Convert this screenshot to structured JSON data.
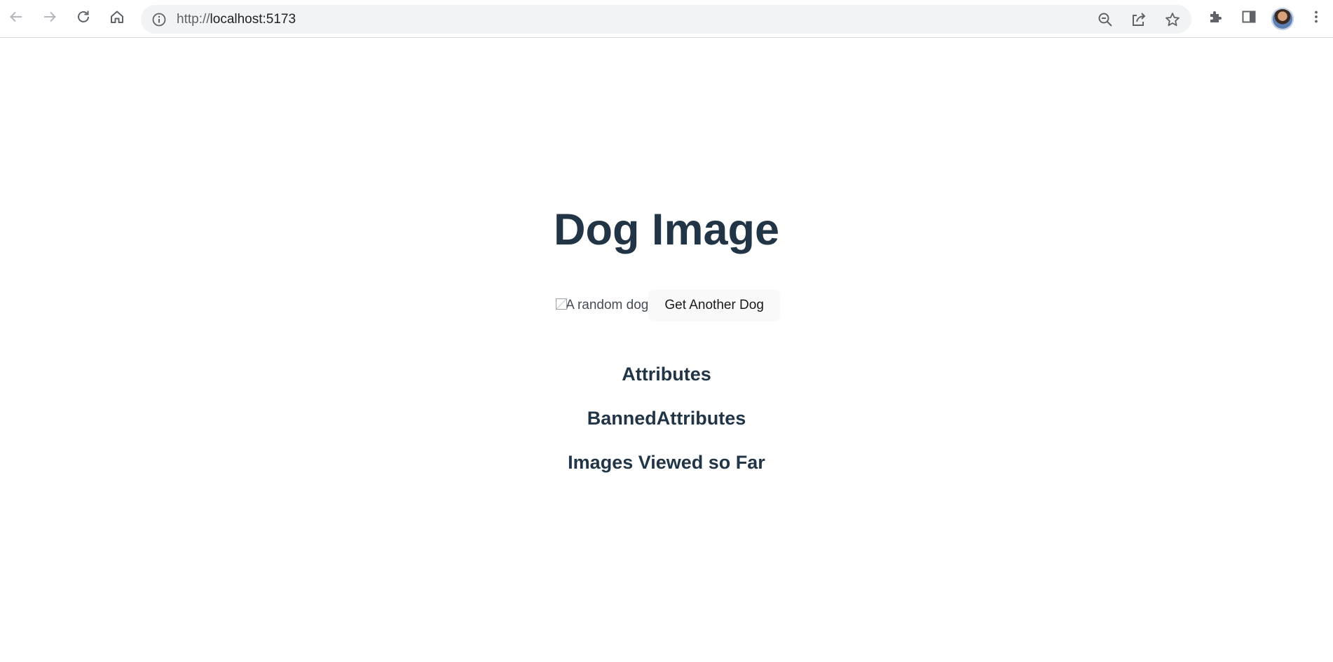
{
  "browser": {
    "url_protocol": "http://",
    "url_host": "localhost:5173",
    "back_icon": "arrow-left-icon",
    "forward_icon": "arrow-right-icon",
    "reload_icon": "reload-icon",
    "home_icon": "home-icon",
    "info_icon": "info-icon",
    "zoom_icon": "zoom-out-icon",
    "share_icon": "share-icon",
    "bookmark_icon": "star-icon",
    "extensions_icon": "puzzle-icon",
    "sidepanel_icon": "side-panel-icon",
    "menu_icon": "more-vert-icon"
  },
  "page": {
    "title": "Dog Image",
    "image_alt": "A random dog",
    "get_button_label": "Get Another Dog",
    "attributes_heading": "Attributes",
    "banned_heading": "BannedAttributes",
    "viewed_heading": "Images Viewed so Far"
  },
  "colors": {
    "heading": "#213547",
    "button_bg": "#f9f9f9",
    "omnibox_bg": "#f1f3f4"
  }
}
